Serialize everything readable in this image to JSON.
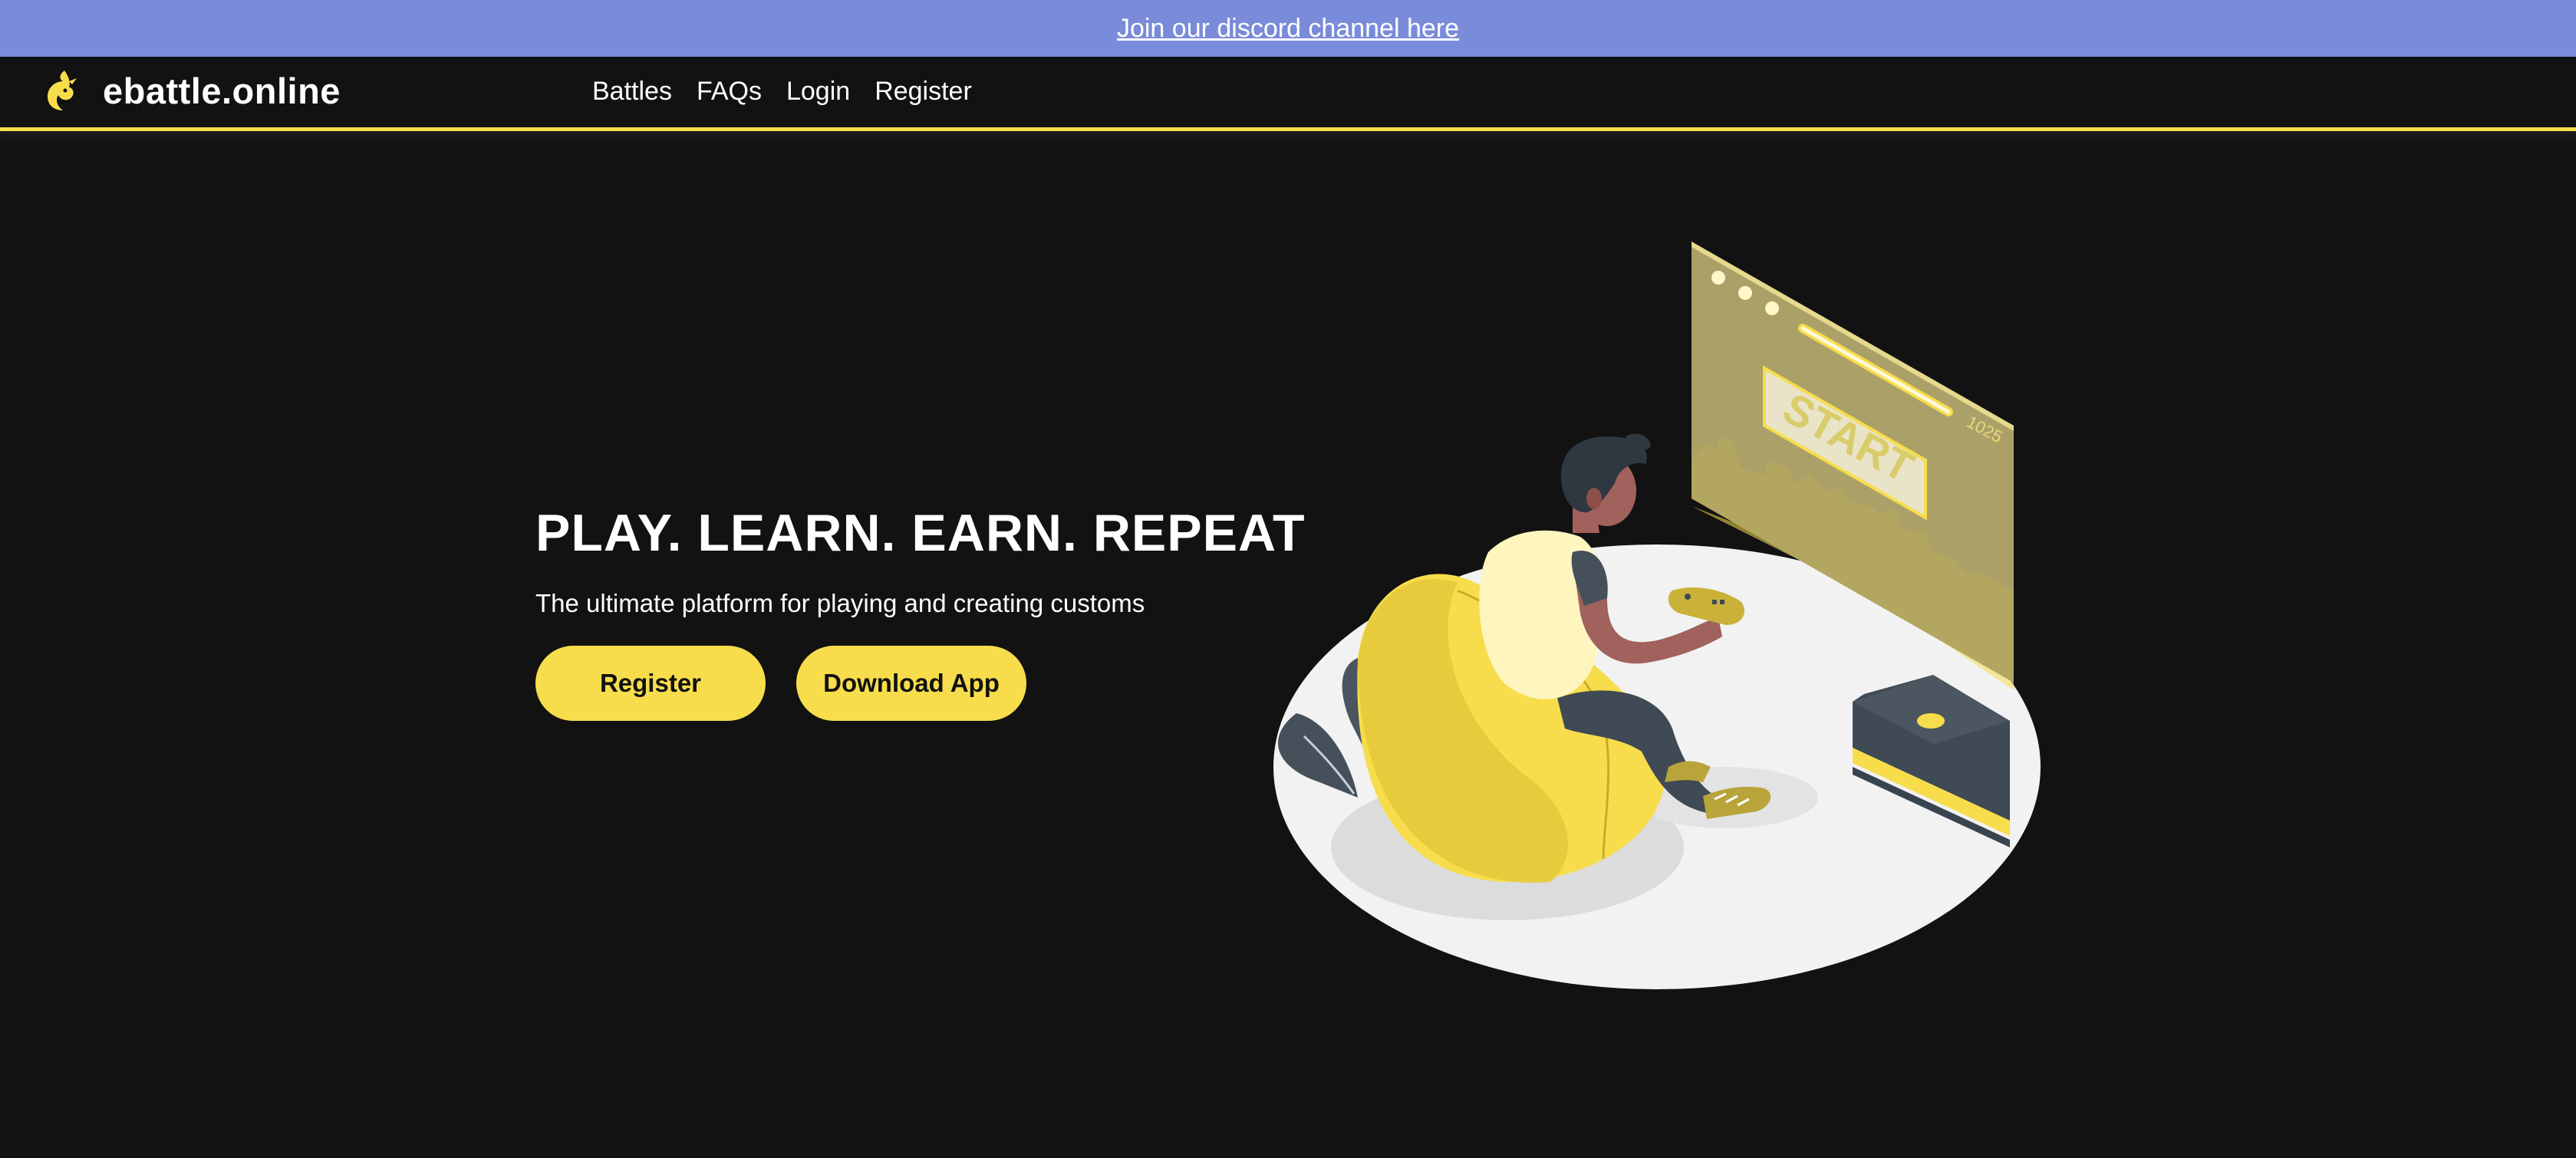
{
  "announcement": {
    "text": "Join our discord channel here"
  },
  "header": {
    "brand_name": "ebattle.online",
    "nav": [
      "Battles",
      "FAQs",
      "Login",
      "Register"
    ]
  },
  "hero": {
    "title": "PLAY. LEARN. EARN. REPEAT",
    "subtitle": "The ultimate platform for playing and creating customs",
    "buttons": {
      "register": "Register",
      "download": "Download App"
    }
  },
  "illustration": {
    "screen_label": "START",
    "score": "1025"
  },
  "colors": {
    "accent": "#f7dd4c",
    "background": "#121212",
    "banner": "#7a8bd9",
    "text": "#ffffff"
  },
  "icons": {
    "logo": "flame-dragon-logo-icon"
  }
}
